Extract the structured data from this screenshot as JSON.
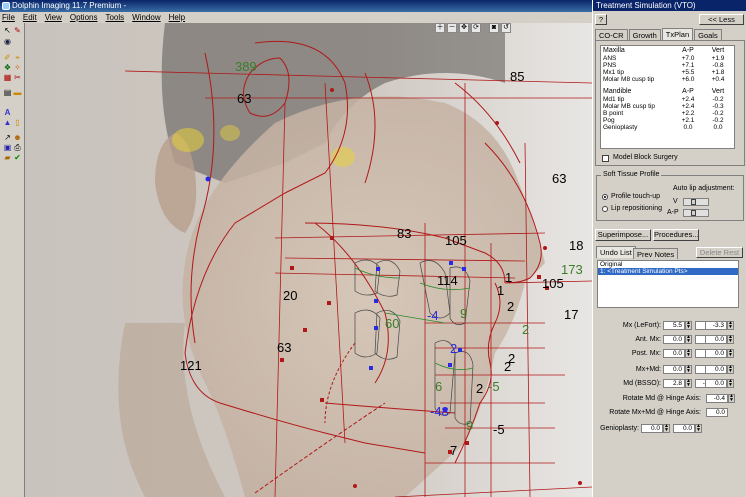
{
  "window": {
    "title": "Dolphin Imaging 11.7 Premium -"
  },
  "menu": [
    "File",
    "Edit",
    "View",
    "Options",
    "Tools",
    "Window",
    "Help"
  ],
  "toolbox_icons": [
    "arrow-select-icon",
    "pen-icon",
    "eye-icon",
    "brush-icon",
    "measure-icon",
    "layers-icon",
    "grid-icon",
    "ruler-icon",
    "text-icon",
    "note-icon",
    "pointer-icon",
    "save-icon",
    "print-icon",
    "check-icon"
  ],
  "canvas_tools": [
    "zoom-in-icon",
    "zoom-out-icon",
    "pan-icon",
    "rotate-icon",
    "camera-icon",
    "reset-icon"
  ],
  "tracing_labels": [
    {
      "text": "389",
      "color": "#3a7d2a"
    },
    {
      "text": "63",
      "color": "#000000"
    },
    {
      "text": "85",
      "color": "#000000"
    },
    {
      "text": "63",
      "color": "#000000"
    },
    {
      "text": "18",
      "color": "#000000"
    },
    {
      "text": "173",
      "color": "#3a7d2a"
    },
    {
      "text": "105",
      "color": "#000000"
    },
    {
      "text": "17",
      "color": "#000000"
    },
    {
      "text": "83",
      "color": "#000000"
    },
    {
      "text": "105",
      "color": "#000000"
    },
    {
      "text": "114",
      "color": "#000000"
    },
    {
      "text": "20",
      "color": "#000000"
    },
    {
      "text": "-4",
      "color": "#2a2ae0"
    },
    {
      "text": "9",
      "color": "#3a7d2a"
    },
    {
      "text": "2",
      "color": "#3a7d2a"
    },
    {
      "text": "60",
      "color": "#3a7d2a"
    },
    {
      "text": "2",
      "color": "#2a2ae0"
    },
    {
      "text": "2",
      "color": "#000000"
    },
    {
      "text": "2",
      "color": "#000000"
    },
    {
      "text": "2",
      "color": "#000000"
    },
    {
      "text": "1",
      "color": "#000000"
    },
    {
      "text": "1",
      "color": "#000000"
    },
    {
      "text": "63",
      "color": "#000000"
    },
    {
      "text": "121",
      "color": "#000000"
    },
    {
      "text": "6",
      "color": "#3a7d2a"
    },
    {
      "text": "-5",
      "color": "#3a7d2a"
    },
    {
      "text": "-48",
      "color": "#2a2ae0"
    },
    {
      "text": "9",
      "color": "#3a7d2a"
    },
    {
      "text": "-5",
      "color": "#000000"
    },
    {
      "text": "7",
      "color": "#000000"
    },
    {
      "text": "2",
      "color": "#000000"
    }
  ],
  "panel": {
    "title": "Treatment Simulation (VTO)",
    "help_label": "?",
    "less_label": "<< Less",
    "tabs": [
      "CO-CR",
      "Growth",
      "TxPlan",
      "Goals"
    ],
    "active_tab": "TxPlan",
    "maxilla": {
      "header": [
        "Maxilla",
        "A-P",
        "Vert"
      ],
      "rows": [
        [
          "ANS",
          "+7.0",
          "+1.9"
        ],
        [
          "PNS",
          "+7.1",
          "-0.8"
        ],
        [
          "Mx1 tip",
          "+5.5",
          "+1.8"
        ],
        [
          "Molar M8 cusp tip",
          "+6.0",
          "+0.4"
        ]
      ]
    },
    "mandible": {
      "header": [
        "Mandible",
        "A-P",
        "Vert"
      ],
      "rows": [
        [
          "Md1 tip",
          "+2.4",
          "-0.2"
        ],
        [
          "Molar MB cusp tip",
          "+2.4",
          "-0.3"
        ],
        [
          "B point",
          "+2.2",
          "-0.2"
        ],
        [
          "Pog",
          "+2.1",
          "-0.2"
        ],
        [
          "Genioplasty",
          "0.0",
          "0.0"
        ]
      ]
    },
    "model_block_label": "Model Block Surgery",
    "soft_tissue": {
      "title": "Soft Tissue Profile",
      "option1": "Profile touch-up",
      "option2": "Lip repositioning",
      "auto_label": "Auto lip adjustment:",
      "v_label": "V",
      "ap_label": "A-P"
    },
    "superimpose_label": "Superimpose...",
    "procedures_label": "Procedures...",
    "undo_tab": "Undo List",
    "prev_notes_tab": "Prev Notes",
    "delete_rest_label": "Delete Rest",
    "undo_items": [
      "Original",
      "1: <Treatment Simulation Pts>"
    ],
    "fields": [
      {
        "label": "Mx (LeFort):",
        "v1": "5.5",
        "v2": "1.8",
        "v3": "-3.3"
      },
      {
        "label": "Ant. Mx:",
        "v1": "0.0",
        "v2": "0.0",
        "v3": "0.0"
      },
      {
        "label": "Post. Mx:",
        "v1": "0.0",
        "v2": "0.0",
        "v3": "0.0"
      },
      {
        "label": "Mx+Md:",
        "v1": "0.0",
        "v2": "0.0",
        "v3": "0.0"
      },
      {
        "label": "Md (BSSO):",
        "v1": "2.8",
        "v2": "-0.8",
        "v3": "0.0"
      }
    ],
    "rotate_md_label": "Rotate Md @ Hinge Axis:",
    "rotate_md_value": "-0.4",
    "rotate_mxmd_label": "Rotate Mx+Md @ Hinge Axis:",
    "rotate_mxmd_value": "0.0",
    "genioplasty_label": "Genioplasty:",
    "genio_v1": "0.0",
    "genio_v2": "0.0"
  }
}
